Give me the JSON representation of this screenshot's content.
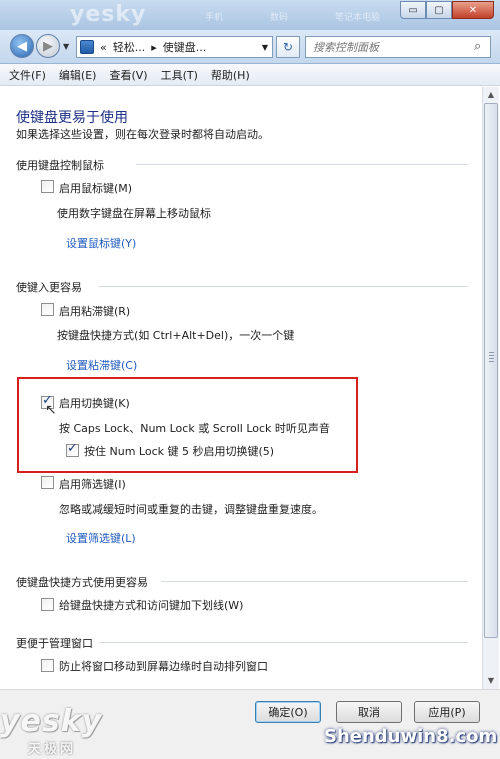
{
  "window": {
    "watermark": "yesky",
    "ghost_text": [
      "手机",
      "数码",
      "笔记本电脑"
    ],
    "controls": {
      "minimize": "▭",
      "maximize": "▢",
      "close": "✕"
    }
  },
  "address": {
    "back_glyph": "◀",
    "forward_glyph": "▶",
    "breadcrumb_prefix": "«",
    "crumbs": [
      "轻松...",
      "使键盘..."
    ],
    "search_placeholder": "搜索控制面板"
  },
  "menu": [
    "文件(F)",
    "编辑(E)",
    "查看(V)",
    "工具(T)",
    "帮助(H)"
  ],
  "page": {
    "title": "使键盘更易于使用",
    "subtitle": "如果选择这些设置，则在每次登录时都将自动启动。"
  },
  "sections": {
    "mouse": {
      "title": "使用键盘控制鼠标",
      "mousekeys_label": "启用鼠标键(M)",
      "mousekeys_checked": false,
      "mousekeys_desc": "使用数字键盘在屏幕上移动鼠标",
      "mousekeys_link": "设置鼠标键(Y)"
    },
    "typing": {
      "title": "使键入更容易",
      "sticky_label": "启用粘滞键(R)",
      "sticky_checked": false,
      "sticky_desc": "按键盘快捷方式(如 Ctrl+Alt+Del)，一次一个键",
      "sticky_link": "设置粘滞键(C)",
      "toggle_label": "启用切换键(K)",
      "toggle_checked": true,
      "toggle_desc": "按 Caps Lock、Num Lock 或 Scroll Lock 时听见声音",
      "toggle_hold_label": "按住 Num Lock 键 5 秒启用切换键(5)",
      "toggle_hold_checked": true,
      "filter_label": "启用筛选键(I)",
      "filter_checked": false,
      "filter_desc": "忽略或减缓短时间或重复的击键，调整键盘重复速度。",
      "filter_link": "设置筛选键(L)"
    },
    "shortcuts": {
      "title": "使键盘快捷方式使用更容易",
      "underline_label": "给键盘快捷方式和访问键加下划线(W)",
      "underline_checked": false
    },
    "windows": {
      "title": "更便于管理窗口",
      "arrange_label": "防止将窗口移动到屏幕边缘时自动排列窗口",
      "arrange_checked": false
    }
  },
  "buttons": {
    "ok": "确定(O)",
    "cancel": "取消",
    "apply": "应用(P)"
  },
  "watermarks": {
    "left_main": "yesky",
    "left_sub": "天极网",
    "right": "Shenduwin8.com"
  }
}
